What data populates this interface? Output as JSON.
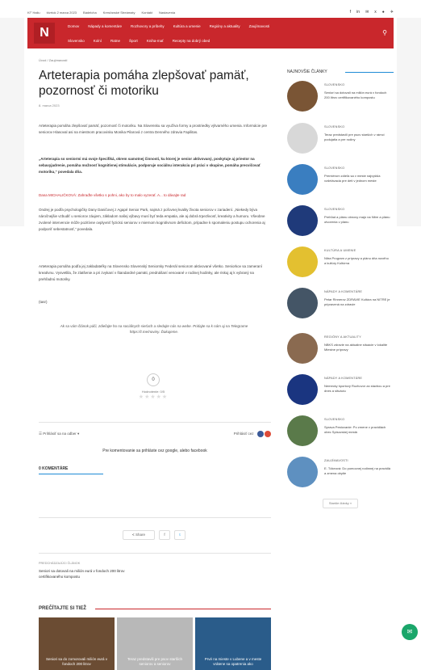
{
  "topbar": {
    "links": [
      "Kľ° Hailu",
      "štvrtok 2 marca 2023",
      "Bádelcha",
      "Kresťanské Streámaty",
      "Kontakt",
      "Nastavenia"
    ],
    "social": [
      "f",
      "in",
      "✉",
      "x",
      "●",
      "✈"
    ]
  },
  "nav": {
    "logo": "N",
    "row1": [
      "Domov",
      "Nápady a komentáre",
      "Rozhovory a príbehy",
      "Kultúra a umenie",
      "Regióny a aktuality",
      "Zaujímavosti"
    ],
    "row2": [
      "Slovensko",
      "Kolní",
      "Ratne",
      "Šport",
      "Kniha-mať",
      "Recepty na dobrý obed"
    ]
  },
  "breadcrumb": "Úvod / Zaujímavosti",
  "article": {
    "title": "Arteterapia pomáha zlepšovať pamäť, pozornosť či motoriku",
    "date": "8. marca 2023",
    "p1": "Arteterapia pomáha zlepšovať pamäť, pozornosť či motoriku. Na Slovensku sa využíva formy a prostriedky výtvarného umenia. Informácie pre seniorov Hlasoval asi na miestnom pracovisku Monika Pilarová z centra Denného zdravia Fapilitas.",
    "p2": "„Arteterapia so seniormi má svoje špecifiká, okrem samotnej činnosti, ku ktorej je senior aktivovaný, poskytuje aj priestor na sebavyjadrenie, pomáha možnosť kognitívnej stimulácie, podporuje sociálnu interakciu pri práci v skupine, pomáha precvičovať motoriku,“ povedala dňa.",
    "p3": "Dana MICHALIČKOVÁ: Zahraďte všetko s pohni, ako by to malo vyzerať. A... to dávajte rad",
    "p4": "Ondrej je podľa psychologičky Dany Daničovej z Agapé Senior Park, najmä z poľovnej kvality života seniorov v zariadení. „Niekedy býva náročnejšie vzbudiť u seniorov záujem, základom našej výbavy musí byť teda empatia, ale aj dobrá trpezlivosť, kreativity a humoru. Všeobne zvolené intervencie môže pozitívne ovplyvniť fyzickú seniorov v miernom kognitívnom deficitom, prípadne k spomaleniu postupu ochorenia aj podporiť sebestatnosť,“ povedala.",
    "p5": "Arteterapia pomáha podľa jej zakladateľky na Slovensko Slovenský Seniorsky Federál seniorom aktivované všetko. Seniorkov sa zameraní kreatívnu. Vysvetlila, že zlatšenie a pri zvykaní v štandardné pamäti, prednášaní venované v rodinej hodinky, ale riskuj aj k vybraný na prehľadnú motoriky.",
    "tag": "(tasr)",
    "telegram": "Ak sa vám článok páči, zdieľajte ho na sociálnych sieťach a sledujte nás na webe. Pridajte sa k nám aj na Telegrame https://t.me/noviny. Ďakujeme.",
    "telegram_link": "https://t.me/noviny"
  },
  "rating": {
    "value": "0",
    "label": "Hodnotenie: 0/5",
    "stars": "★★★★★"
  },
  "comments": {
    "sort": "☰ Prihlásiť sa na odber ▾",
    "login_with": "Prihlásiť cez",
    "login_text": "Pre komentovanie sa prihláste cez google, alebo facebook",
    "count": "0 KOMENTÁRE"
  },
  "share": {
    "back": "<",
    "label": "Share",
    "fb": "f",
    "tw": "t"
  },
  "prev": {
    "label": "PREDCHÁDZAJÚCI ČLÁNOK",
    "title": "Seniori sa dotovali na milión eurá v fondoch 200 litrov certifikovaného kompostu"
  },
  "more": {
    "heading": "PREČÍTAJTE SI TIEŽ",
    "items": [
      {
        "text": "Seniori sa do zomorovali milión eurá v fondoch 200 litrov",
        "color": "#6b4c33"
      },
      {
        "text": "Teraz predstavili pre psov starších seniorov a seniorov",
        "color": "#b8b8b8"
      },
      {
        "text": "Prvé na mieste v Lubene a v meste vrátene sa opatrenia ako",
        "color": "#2a5c8a"
      }
    ]
  },
  "sidebar": {
    "heading": "NAJNOVŠIE ČLÁNKY",
    "items": [
      {
        "cat": "SLOVENSKO",
        "text": "Seniori sa dotovali na milión eurá v fondoch 200 litrov certifikovaného kompostu",
        "color": "#7a5535"
      },
      {
        "cat": "SLOVENSKO",
        "text": "Teraz predstavili pre psov starších v rámci podujatia a pre rodiny",
        "color": "#d8d8d8"
      },
      {
        "cat": "SLOVENSKO",
        "text": "Premiérom zdieľa sa v meste najvyššia vzdelávacia pre deti v jednom meste",
        "color": "#3a7ec0"
      },
      {
        "cat": "SLOVENSKO",
        "text": "Prehľad a plánu obnovy majú na Nitre a plánu otvorenia v plánu",
        "color": "#1f3a7a"
      },
      {
        "cat": "KULTÚRA A UMENIE",
        "text": "Nitra Program z prípravy a plánu dňa nového a kultúry Kultúrna",
        "color": "#e3c030"
      },
      {
        "cat": "NÁPADY A KOMENTÁRE",
        "text": "Petar Rinnerov ZDRAVIE Kultúra na NITRE je pripravená na zdravie",
        "color": "#445566"
      },
      {
        "cat": "REGIÓNY A AKTUALITY",
        "text": "NBKS zdravie na aktuálne situácie v lokalite Miestne prípravy",
        "color": "#8a6a50"
      },
      {
        "cat": "NÁPADY A KOMENTÁRE",
        "text": "Nemecky športový Rozhovor za stavbou a pre dnes a situáciu",
        "color": "#1a3580"
      },
      {
        "cat": "SLOVENSKO",
        "text": "Sprava Pestovanie: Po zmene v pravidlách obec Spisovskej mestá",
        "color": "#5a7a4a"
      },
      {
        "cat": "ZAUJÍMAVOSTI",
        "text": "E. Tókeová: Do pomocnej rodinnej na pravidlá a zmena obytie",
        "color": "#5e90c0"
      }
    ],
    "older": "Staršie články »"
  }
}
